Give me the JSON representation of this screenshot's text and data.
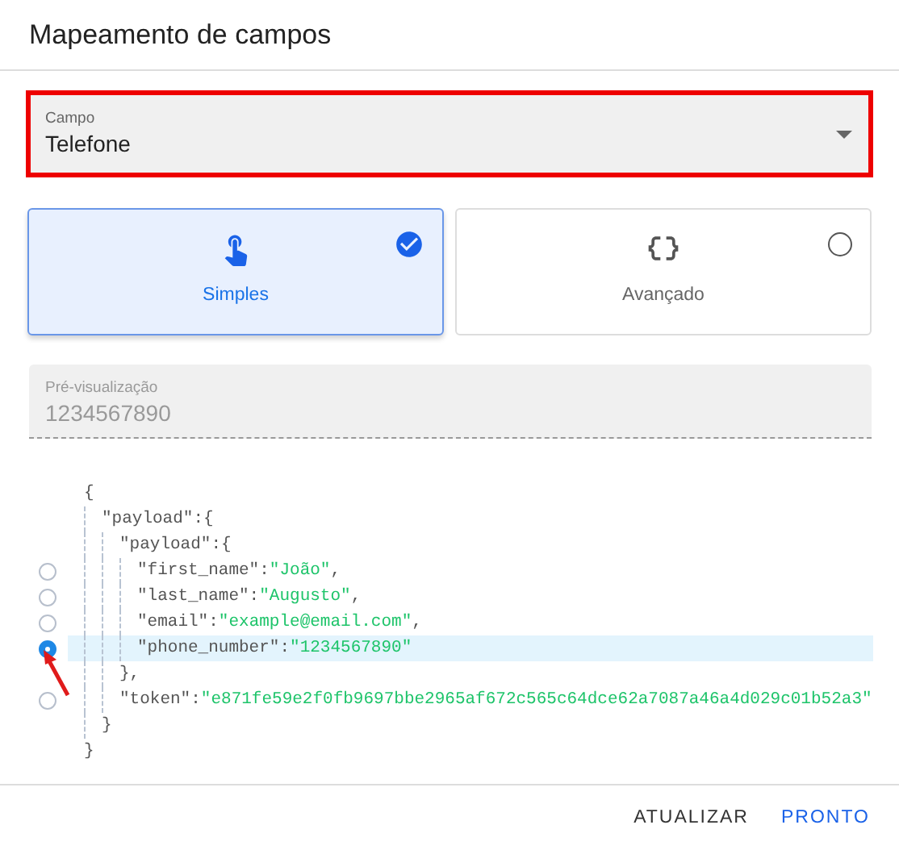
{
  "dialog": {
    "title": "Mapeamento de campos"
  },
  "field_select": {
    "label": "Campo",
    "value": "Telefone",
    "highlighted": true
  },
  "mode_cards": [
    {
      "kind": "simple",
      "label": "Simples",
      "selected": true
    },
    {
      "kind": "advanced",
      "label": "Avançado",
      "selected": false
    }
  ],
  "preview": {
    "label": "Pré-visualização",
    "value": "1234567890"
  },
  "json_tree": {
    "open": "{",
    "close": "}",
    "children": [
      {
        "key": "\"payload\":",
        "open": "{",
        "close": "}",
        "children": [
          {
            "key": "\"payload\":",
            "open": "{",
            "close": "},",
            "children": [
              {
                "key": "\"first_name\":",
                "value": "\"João\"",
                "tail": ",",
                "selected": false
              },
              {
                "key": "\"last_name\":",
                "value": "\"Augusto\"",
                "tail": ",",
                "selected": false
              },
              {
                "key": "\"email\":",
                "value": "\"example@email.com\"",
                "tail": ",",
                "selected": false
              },
              {
                "key": "\"phone_number\":",
                "value": "\"1234567890\"",
                "selected": true
              }
            ]
          },
          {
            "key": "\"token\":",
            "value": "\"e871fe59e2f0fb9697bbe2965af672c565c64dce62a7087a46a4d029c01b52a3\"",
            "selected": false
          }
        ]
      }
    ]
  },
  "pointer_arrow": true,
  "buttons": [
    {
      "label": "ATUALIZAR",
      "kind": "secondary"
    },
    {
      "label": "PRONTO",
      "kind": "primary"
    }
  ]
}
